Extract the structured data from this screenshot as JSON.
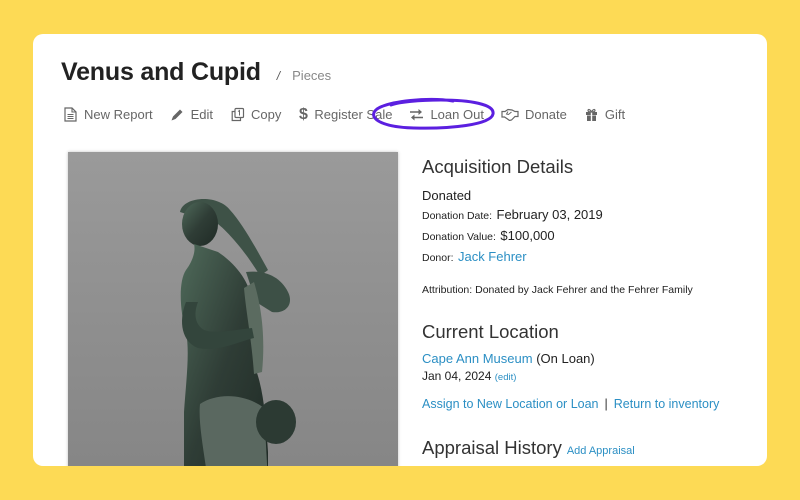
{
  "colors": {
    "background": "#FDDA55",
    "card": "#FFFFFF",
    "link": "#2B8FC4",
    "annotation": "#5B1FE0",
    "toolbar_text": "#666666"
  },
  "header": {
    "title": "Venus and Cupid",
    "separator": "/",
    "breadcrumb": "Pieces"
  },
  "toolbar": {
    "items": [
      {
        "label": "New Report",
        "icon": "document-icon"
      },
      {
        "label": "Edit",
        "icon": "pencil-icon"
      },
      {
        "label": "Copy",
        "icon": "copy-icon"
      },
      {
        "label": "Register Sale",
        "icon": "dollar-icon"
      },
      {
        "label": "Loan Out",
        "icon": "swap-arrows-icon",
        "highlighted": true
      },
      {
        "label": "Donate",
        "icon": "handshake-icon"
      },
      {
        "label": "Gift",
        "icon": "gift-icon"
      }
    ]
  },
  "image": {
    "alt": "Bronze statue of Venus and Cupid"
  },
  "acquisition": {
    "heading": "Acquisition Details",
    "status": "Donated",
    "donation_date_label": "Donation Date:",
    "donation_date": "February 03, 2019",
    "donation_value_label": "Donation Value:",
    "donation_value": "$100,000",
    "donor_label": "Donor:",
    "donor": "Jack Fehrer",
    "attribution": "Attribution: Donated by Jack Fehrer and the Fehrer Family"
  },
  "location": {
    "heading": "Current Location",
    "name": "Cape Ann Museum",
    "status": "(On Loan)",
    "date": "Jan 04, 2024",
    "edit_label": "(edit)",
    "assign_label": "Assign to New Location or Loan",
    "separator": "|",
    "return_label": "Return to inventory"
  },
  "appraisal": {
    "heading": "Appraisal History",
    "add_label": "Add Appraisal"
  }
}
